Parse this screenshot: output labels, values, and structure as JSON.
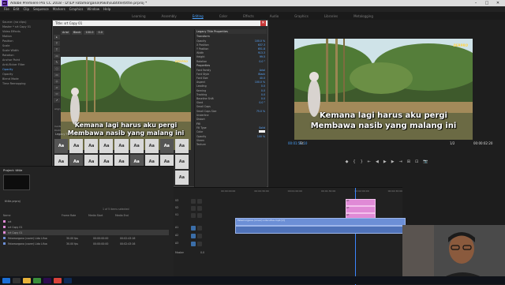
{
  "app": {
    "title": "Adobe Premiere Pro CC 2018 - D:\\LP Fatamorgana\\Pakd\\subtitle\\tittle.prproj *",
    "logo": "Pr",
    "window_controls": [
      "–",
      "□",
      "✕"
    ]
  },
  "menu": [
    "File",
    "Edit",
    "Clip",
    "Sequence",
    "Markers",
    "Graphics",
    "Window",
    "Help"
  ],
  "workspaces": {
    "items": [
      "Learning",
      "Assembly",
      "Editing",
      "Color",
      "Effects",
      "Audio",
      "Graphics",
      "Libraries",
      "Metalogging"
    ],
    "active": "Editing"
  },
  "source_panel": {
    "header": "Source: (no clips)",
    "items": [
      "Master * srt Copy 01",
      "Video Effects",
      "Motion",
      "Position",
      "Scale",
      "Scale Width",
      "Rotation",
      "Anchor Point",
      "Anti-flicker Filter",
      "Opacity",
      "Opacity",
      "Blend Mode",
      "Time Remapping"
    ],
    "highlight_index": 9
  },
  "legacy_title": {
    "title": "Title: srt Copy 01",
    "font_field": "Arial",
    "style_field": "Black",
    "size_field": "100.0",
    "kerning_field": "0.0",
    "tools": [
      "▸",
      "T",
      "T",
      "▭",
      "✎",
      "○",
      "▭",
      "◇",
      "▱",
      "⬭",
      "↗"
    ],
    "aa_label": "Aa",
    "styles_header": "Legacy Title Styles",
    "style_swatch_label": "Aa",
    "close_icon": "✕",
    "tool_caption_1": "Align",
    "tool_caption_2": "Center",
    "tool_caption_3": "Distribute"
  },
  "subtitle": {
    "line1": "Kemana lagi harus aku pergi",
    "line2": "Membawa nasib yang malang ini"
  },
  "watermark": "DERPRO",
  "properties": {
    "title": "Legacy Title Properties",
    "transform_label": "Transform",
    "transform": [
      {
        "k": "Opacity",
        "v": "100.0 %"
      },
      {
        "k": "X Position",
        "v": "637.3"
      },
      {
        "k": "Y Position",
        "v": "651.8"
      },
      {
        "k": "Width",
        "v": "913.3"
      },
      {
        "k": "Height",
        "v": "99.5"
      },
      {
        "k": "Rotation",
        "v": "0.0 °"
      }
    ],
    "properties_label": "Properties",
    "props": [
      {
        "k": "Font Family",
        "v": "Arial"
      },
      {
        "k": "Font Style",
        "v": "Black"
      },
      {
        "k": "Font Size",
        "v": "40.0"
      },
      {
        "k": "Aspect",
        "v": "100.0 %"
      },
      {
        "k": "Leading",
        "v": "0.0"
      },
      {
        "k": "Kerning",
        "v": "0.0"
      },
      {
        "k": "Tracking",
        "v": "0.0"
      },
      {
        "k": "Baseline Shift",
        "v": "0.0"
      },
      {
        "k": "Slant",
        "v": "0.0 °"
      },
      {
        "k": "Small Caps",
        "v": ""
      },
      {
        "k": "Small Caps Size",
        "v": "75.0 %"
      },
      {
        "k": "Underline",
        "v": ""
      },
      {
        "k": "Distort",
        "v": ""
      }
    ],
    "fill_label": "Fill",
    "fill": [
      {
        "k": "Fill Type",
        "v": "Solid"
      },
      {
        "k": "Color",
        "v": ""
      },
      {
        "k": "Opacity",
        "v": "100 %"
      },
      {
        "k": "Sheen",
        "v": ""
      },
      {
        "k": "Texture",
        "v": ""
      }
    ]
  },
  "program": {
    "timecode_left": "00:01:51:10",
    "fit": "Fit",
    "timecode_right": "00:00:02:20",
    "ratio": "1/2",
    "controls": [
      "◆",
      "{",
      "}",
      "⇤",
      "◀",
      "▶",
      "▶",
      "⇥",
      "⊞",
      "⊡",
      "📷"
    ]
  },
  "project": {
    "tab": "Project: tittle",
    "search_hint": "tittle.prproj",
    "items_count": "1 of 5 items selected",
    "columns": [
      "Name",
      "Frame Rate",
      "Media Start",
      "Media End"
    ],
    "rows": [
      {
        "name": "srt",
        "rate": "",
        "start": "",
        "end": ""
      },
      {
        "name": "srt Copy 01",
        "rate": "",
        "start": "",
        "end": ""
      },
      {
        "name": "srt Copy 01",
        "rate": "",
        "start": "",
        "end": ""
      },
      {
        "name": "Fatamorgana (cover) Lida Lifua",
        "rate": "30.00 fps",
        "start": "00:00:00:00",
        "end": "00:02:43:16"
      },
      {
        "name": "Fatamorgana (cover) Lida Lifua",
        "rate": "30.00 fps",
        "start": "00:00:00:00",
        "end": "00:02:43:16"
      }
    ]
  },
  "timeline": {
    "ruler": [
      "00:00:00:00",
      "00:00:30:00",
      "00:01:00:00",
      "00:01:30:00",
      "00:02:00:00",
      "00:02:30:00"
    ],
    "tracks": [
      "V3",
      "V2",
      "V1",
      "A1",
      "A2",
      "A3",
      "Master"
    ],
    "video_clip": "Fatamorgana (cover) Lida Lifua.mp4 [V]",
    "master_value": "0.0",
    "clip_labels": [
      "srt",
      "srt",
      "srt"
    ]
  }
}
